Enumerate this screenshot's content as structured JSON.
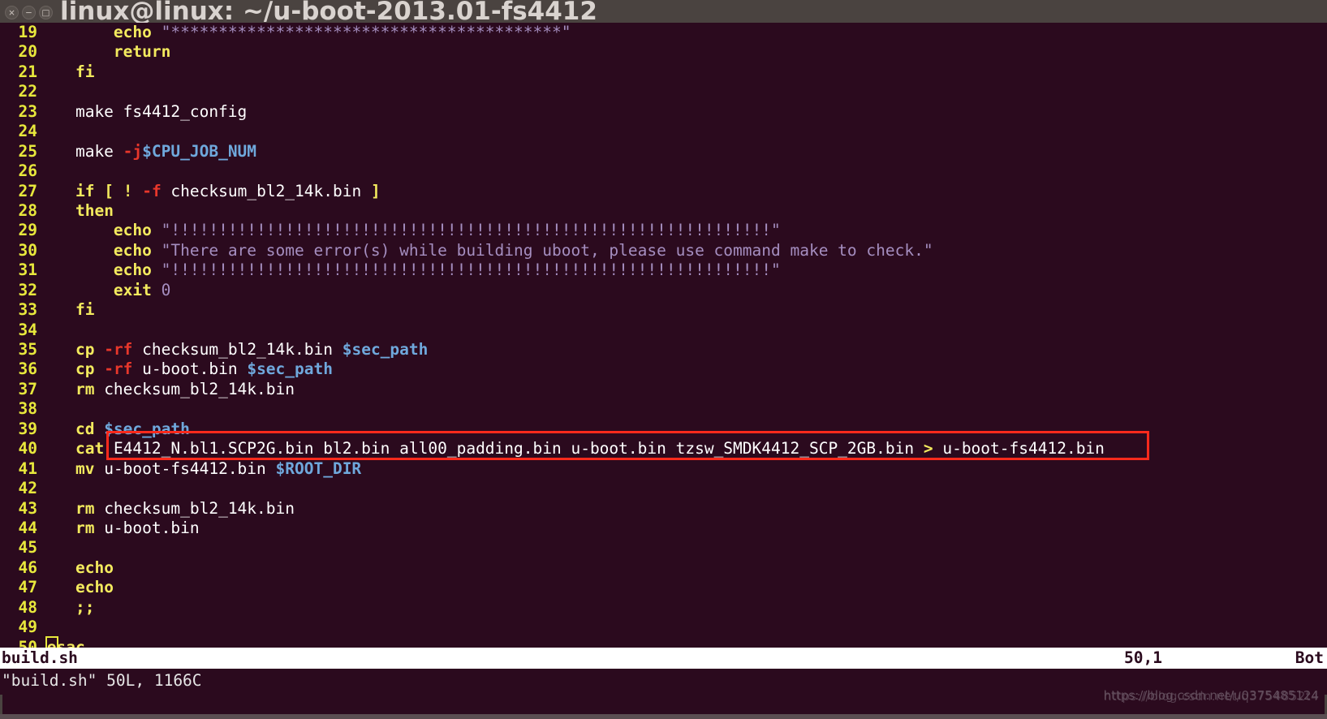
{
  "window": {
    "title": "linux@linux: ~/u-boot-2013.01-fs4412",
    "controls": {
      "close": "×",
      "minimize": "−",
      "maximize": "□"
    }
  },
  "theme": {
    "background": "#2b0a1e",
    "titlebar": "#4a4340",
    "line_number": "#e8e83c",
    "keyword": "#f3ea5e",
    "string": "#a58ec0",
    "flag": "#e8372b",
    "variable": "#6fa8dc",
    "plain_text": "#ffffff",
    "annotation_box": "#ff2a1c",
    "statusline_bg": "#ffffff",
    "statusline_fg": "#2b0a1e"
  },
  "editor": {
    "lines": [
      {
        "n": "19",
        "tokens": [
          {
            "t": "        ",
            "c": "plain"
          },
          {
            "t": "echo",
            "c": "kw"
          },
          {
            "t": " ",
            "c": "plain"
          },
          {
            "t": "\"*****************************************\"",
            "c": "str"
          }
        ]
      },
      {
        "n": "20",
        "tokens": [
          {
            "t": "        ",
            "c": "plain"
          },
          {
            "t": "return",
            "c": "kw"
          }
        ]
      },
      {
        "n": "21",
        "tokens": [
          {
            "t": "    ",
            "c": "plain"
          },
          {
            "t": "fi",
            "c": "kw"
          }
        ]
      },
      {
        "n": "22",
        "tokens": []
      },
      {
        "n": "23",
        "tokens": [
          {
            "t": "    make fs4412_config",
            "c": "plain"
          }
        ]
      },
      {
        "n": "24",
        "tokens": []
      },
      {
        "n": "25",
        "tokens": [
          {
            "t": "    make ",
            "c": "plain"
          },
          {
            "t": "-j",
            "c": "flag"
          },
          {
            "t": "$CPU_JOB_NUM",
            "c": "var"
          }
        ]
      },
      {
        "n": "26",
        "tokens": []
      },
      {
        "n": "27",
        "tokens": [
          {
            "t": "    ",
            "c": "plain"
          },
          {
            "t": "if",
            "c": "kw"
          },
          {
            "t": " ",
            "c": "plain"
          },
          {
            "t": "[",
            "c": "kw"
          },
          {
            "t": " ",
            "c": "plain"
          },
          {
            "t": "!",
            "c": "kw"
          },
          {
            "t": " ",
            "c": "plain"
          },
          {
            "t": "-f",
            "c": "flag"
          },
          {
            "t": " checksum_bl2_14k.bin ",
            "c": "plain"
          },
          {
            "t": "]",
            "c": "kw"
          }
        ]
      },
      {
        "n": "28",
        "tokens": [
          {
            "t": "    ",
            "c": "plain"
          },
          {
            "t": "then",
            "c": "kw"
          }
        ]
      },
      {
        "n": "29",
        "tokens": [
          {
            "t": "        ",
            "c": "plain"
          },
          {
            "t": "echo",
            "c": "kw"
          },
          {
            "t": " ",
            "c": "plain"
          },
          {
            "t": "\"!!!!!!!!!!!!!!!!!!!!!!!!!!!!!!!!!!!!!!!!!!!!!!!!!!!!!!!!!!!!!!!\"",
            "c": "str"
          }
        ]
      },
      {
        "n": "30",
        "tokens": [
          {
            "t": "        ",
            "c": "plain"
          },
          {
            "t": "echo",
            "c": "kw"
          },
          {
            "t": " ",
            "c": "plain"
          },
          {
            "t": "\"There are some error(s) while building uboot, please use command make to check.\"",
            "c": "str"
          }
        ]
      },
      {
        "n": "31",
        "tokens": [
          {
            "t": "        ",
            "c": "plain"
          },
          {
            "t": "echo",
            "c": "kw"
          },
          {
            "t": " ",
            "c": "plain"
          },
          {
            "t": "\"!!!!!!!!!!!!!!!!!!!!!!!!!!!!!!!!!!!!!!!!!!!!!!!!!!!!!!!!!!!!!!!\"",
            "c": "str"
          }
        ]
      },
      {
        "n": "32",
        "tokens": [
          {
            "t": "        ",
            "c": "plain"
          },
          {
            "t": "exit",
            "c": "kw"
          },
          {
            "t": " ",
            "c": "plain"
          },
          {
            "t": "0",
            "c": "num"
          }
        ]
      },
      {
        "n": "33",
        "tokens": [
          {
            "t": "    ",
            "c": "plain"
          },
          {
            "t": "fi",
            "c": "kw"
          }
        ]
      },
      {
        "n": "34",
        "tokens": []
      },
      {
        "n": "35",
        "tokens": [
          {
            "t": "    ",
            "c": "plain"
          },
          {
            "t": "cp",
            "c": "kw"
          },
          {
            "t": " ",
            "c": "plain"
          },
          {
            "t": "-rf",
            "c": "flag"
          },
          {
            "t": " checksum_bl2_14k.bin ",
            "c": "plain"
          },
          {
            "t": "$sec_path",
            "c": "var"
          }
        ]
      },
      {
        "n": "36",
        "tokens": [
          {
            "t": "    ",
            "c": "plain"
          },
          {
            "t": "cp",
            "c": "kw"
          },
          {
            "t": " ",
            "c": "plain"
          },
          {
            "t": "-rf",
            "c": "flag"
          },
          {
            "t": " u-boot.bin ",
            "c": "plain"
          },
          {
            "t": "$sec_path",
            "c": "var"
          }
        ]
      },
      {
        "n": "37",
        "tokens": [
          {
            "t": "    ",
            "c": "plain"
          },
          {
            "t": "rm",
            "c": "kw"
          },
          {
            "t": " checksum_bl2_14k.bin",
            "c": "plain"
          }
        ]
      },
      {
        "n": "38",
        "tokens": []
      },
      {
        "n": "39",
        "tokens": [
          {
            "t": "    ",
            "c": "plain"
          },
          {
            "t": "cd",
            "c": "kw"
          },
          {
            "t": " ",
            "c": "plain"
          },
          {
            "t": "$sec_path",
            "c": "var"
          }
        ]
      },
      {
        "n": "40",
        "tokens": [
          {
            "t": "    ",
            "c": "plain"
          },
          {
            "t": "cat",
            "c": "kw"
          },
          {
            "t": " E4412_N.bl1.SCP2G.bin bl2.bin all00_padding.bin u-boot.bin tzsw_SMDK4412_SCP_2GB.bin ",
            "c": "plain"
          },
          {
            "t": ">",
            "c": "redir"
          },
          {
            "t": " u-boot-fs4412.bin",
            "c": "plain"
          }
        ]
      },
      {
        "n": "41",
        "tokens": [
          {
            "t": "    ",
            "c": "plain"
          },
          {
            "t": "mv",
            "c": "kw"
          },
          {
            "t": " u-boot-fs4412.bin ",
            "c": "plain"
          },
          {
            "t": "$ROOT_DIR",
            "c": "var"
          }
        ]
      },
      {
        "n": "42",
        "tokens": []
      },
      {
        "n": "43",
        "tokens": [
          {
            "t": "    ",
            "c": "plain"
          },
          {
            "t": "rm",
            "c": "kw"
          },
          {
            "t": " checksum_bl2_14k.bin",
            "c": "plain"
          }
        ]
      },
      {
        "n": "44",
        "tokens": [
          {
            "t": "    ",
            "c": "plain"
          },
          {
            "t": "rm",
            "c": "kw"
          },
          {
            "t": " u-boot.bin",
            "c": "plain"
          }
        ]
      },
      {
        "n": "45",
        "tokens": []
      },
      {
        "n": "46",
        "tokens": [
          {
            "t": "    ",
            "c": "plain"
          },
          {
            "t": "echo",
            "c": "kw"
          }
        ]
      },
      {
        "n": "47",
        "tokens": [
          {
            "t": "    ",
            "c": "plain"
          },
          {
            "t": "echo",
            "c": "kw"
          }
        ]
      },
      {
        "n": "48",
        "tokens": [
          {
            "t": "    ",
            "c": "plain"
          },
          {
            "t": ";;",
            "c": "kw"
          }
        ]
      },
      {
        "n": "49",
        "tokens": []
      },
      {
        "n": "50",
        "tokens": [
          {
            "t": " ",
            "c": "plain"
          },
          {
            "t": "e",
            "c": "kw",
            "cursor": true
          },
          {
            "t": "sac",
            "c": "kw"
          }
        ]
      }
    ]
  },
  "statusline": {
    "filename": "build.sh",
    "position": "50,1",
    "scroll": "Bot"
  },
  "commandline": {
    "text": "\"build.sh\" 50L, 1166C"
  },
  "watermark": {
    "line1": "https://blog.csdn.net/u0375485124",
    "line2": "https://blog.csdn.net/q3754852t4"
  }
}
